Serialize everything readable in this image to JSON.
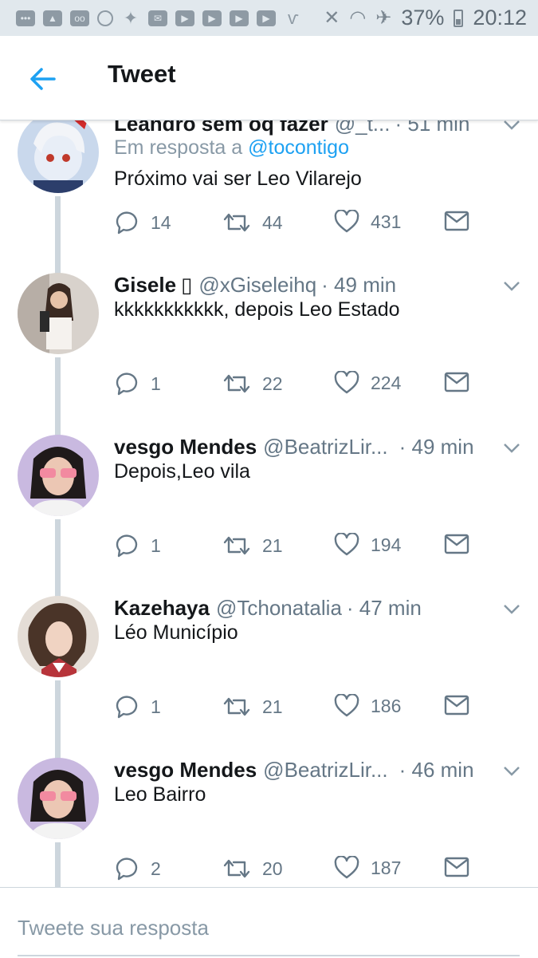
{
  "status_bar": {
    "battery": "37%",
    "time": "20:12",
    "icons": [
      "chat-bubble-icon",
      "image-icon",
      "voicemail-icon",
      "whatsapp-icon",
      "twitter-icon",
      "mail-icon",
      "youtube-icon",
      "youtube-icon",
      "youtube-icon",
      "youtube-icon",
      "vivo-icon",
      "mute-icon",
      "wifi-icon",
      "airplane-icon",
      "battery-icon"
    ]
  },
  "header": {
    "title": "Tweet",
    "back_icon": "arrow-left-icon"
  },
  "colors": {
    "link": "#1da1f2",
    "muted": "#657786",
    "thread": "#cdd6dd"
  },
  "tweets": [
    {
      "name": "Leandro sem oq fazer",
      "handle": "@_t...",
      "time": "· 51 min",
      "reply_prefix": "Em resposta a ",
      "reply_handle": "@tocontigo",
      "text": "Próximo vai ser Leo Vilarejo",
      "replies": "14",
      "retweets": "44",
      "likes": "431"
    },
    {
      "name": "Gisele",
      "name_glyph": "▯",
      "handle": "@xGiseleihq",
      "time": "· 49 min",
      "text": "kkkkkkkkkkk, depois Leo Estado",
      "replies": "1",
      "retweets": "22",
      "likes": "224"
    },
    {
      "name": "vesgo Mendes",
      "handle": "@BeatrizLir...",
      "time": "· 49 min",
      "text": "Depois,Leo vila",
      "replies": "1",
      "retweets": "21",
      "likes": "194"
    },
    {
      "name": "Kazehaya",
      "handle": "@Tchonatalia",
      "time": "· 47 min",
      "text": "Léo Município",
      "replies": "1",
      "retweets": "21",
      "likes": "186"
    },
    {
      "name": "vesgo Mendes",
      "handle": "@BeatrizLir...",
      "time": "· 46 min",
      "text": "Leo Bairro",
      "replies": "2",
      "retweets": "20",
      "likes": "187"
    }
  ],
  "reply_bar": {
    "placeholder": "Tweete sua resposta"
  }
}
